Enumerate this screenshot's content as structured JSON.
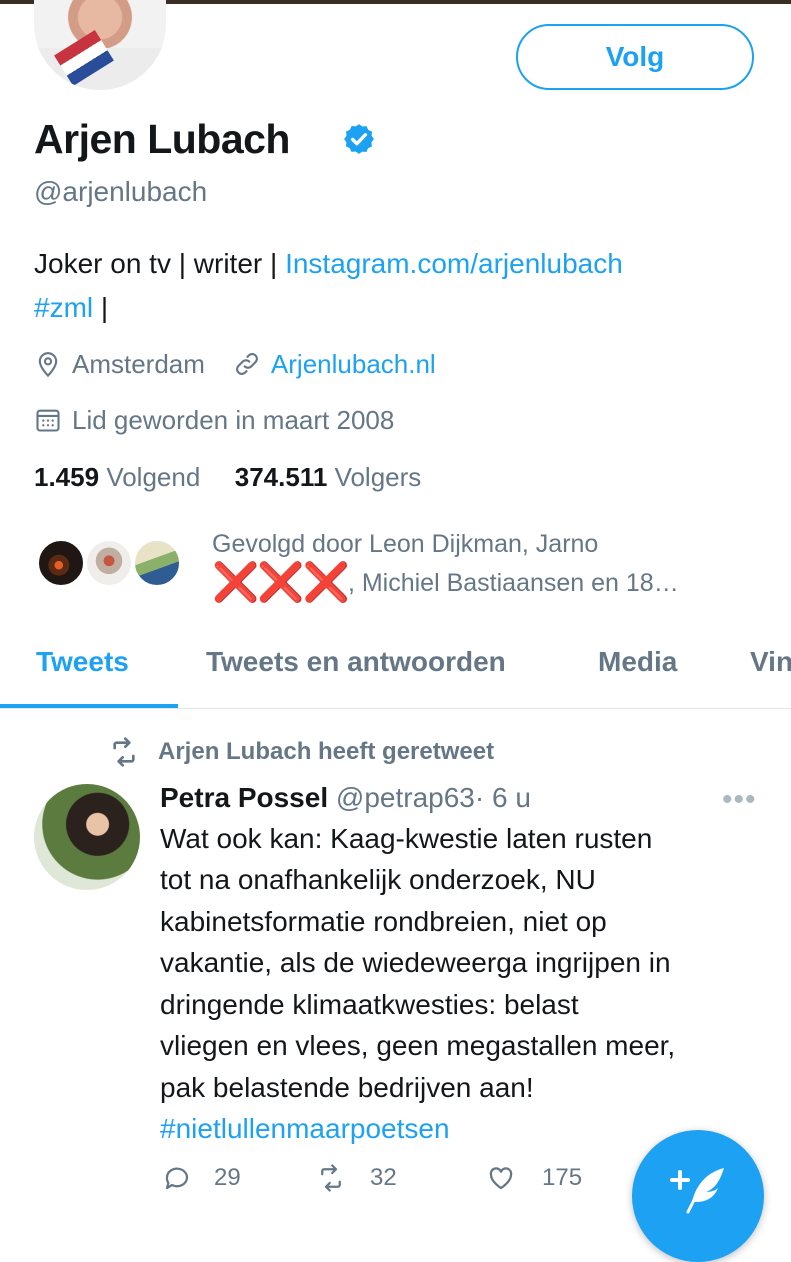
{
  "profile": {
    "follow_label": "Volg",
    "name": "Arjen Lubach",
    "handle": "@arjenlubach",
    "bio_text": "Joker on tv | writer | ",
    "bio_link": "Instagram.com/arjenlubach",
    "bio_hashtag": "#zml",
    "bio_end": " |",
    "location": "Amsterdam",
    "website": "Arjenlubach.nl",
    "joined": "Lid geworden in maart 2008",
    "following_count": "1.459",
    "following_label": "Volgend",
    "followers_count": "374.511",
    "followers_label": "Volgers",
    "followed_by_line1": "Gevolgd door Leon Dijkman, Jarno",
    "followed_by_xxx": "❌❌❌",
    "followed_by_line2": ", Michiel Bastiaansen en 18…"
  },
  "tabs": [
    {
      "label": "Tweets"
    },
    {
      "label": "Tweets en antwoorden"
    },
    {
      "label": "Media"
    },
    {
      "label": "Vin"
    }
  ],
  "tweet": {
    "retweet_label": "Arjen Lubach heeft geretweet",
    "author_name": "Petra Possel",
    "author_handle": "@petrap63",
    "time": "· 6 u",
    "more": "•••",
    "lines": [
      "Wat ook kan: Kaag-kwestie laten rusten",
      "tot na onafhankelijk onderzoek, NU",
      "kabinetsformatie rondbreien, niet op",
      "vakantie, als de wiedeweerga ingrijpen in",
      "dringende klimaatkwesties: belast",
      "vliegen en vlees, geen megastallen meer,",
      "pak belastende bedrijven aan!"
    ],
    "hashtag": "#nietlullenmaarpoetsen",
    "reply_count": "29",
    "retweet_count": "32",
    "like_count": "175"
  },
  "colors": {
    "accent": "#1da1f2",
    "secondary_text": "#657786",
    "primary_text": "#14171a"
  }
}
